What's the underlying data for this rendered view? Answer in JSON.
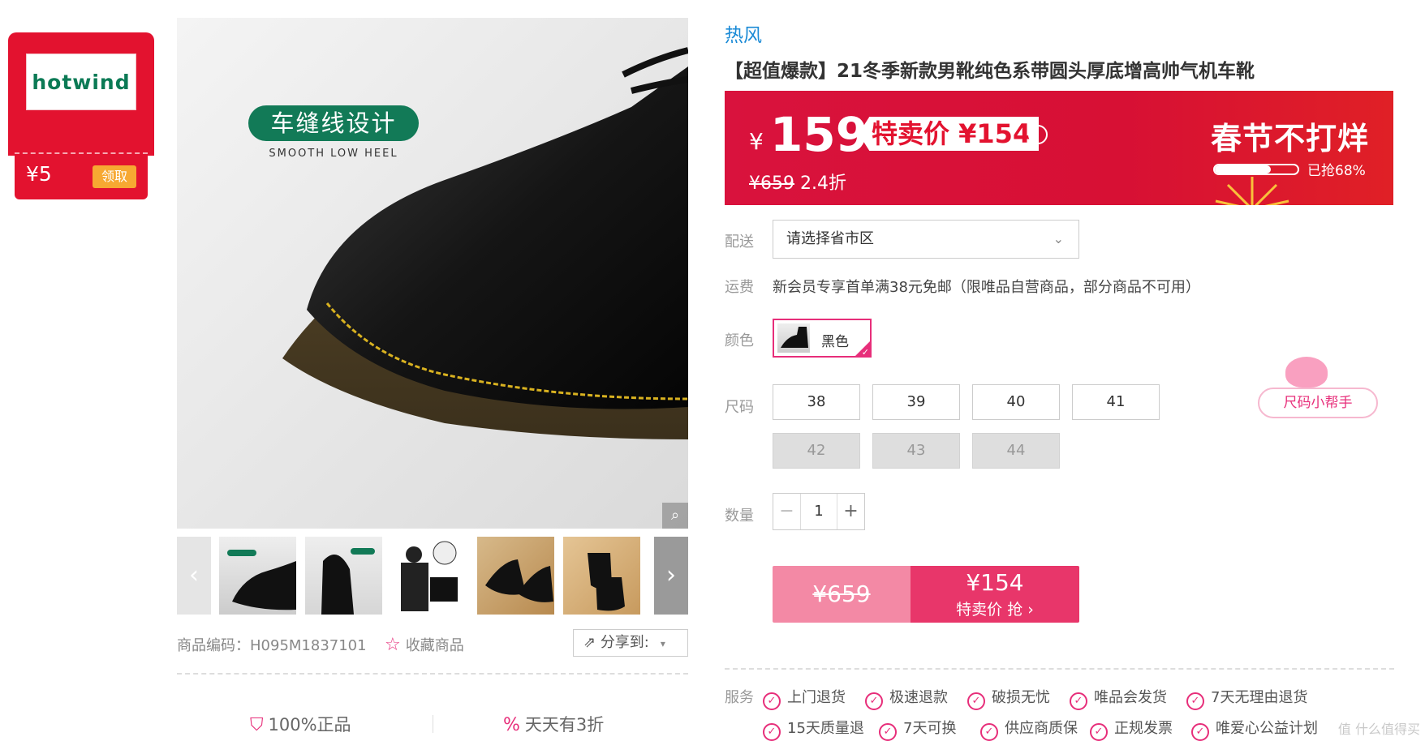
{
  "coupon": {
    "brand_logo": "hotwind",
    "amount": "¥5",
    "claim": "领取"
  },
  "gallery": {
    "badge_title": "车缝线设计",
    "badge_sub": "SMOOTH LOW HEEL",
    "prev_icon": "chevron-left-icon",
    "next_icon": "chevron-right-icon",
    "zoom_icon": "magnifier-icon",
    "thumbs": [
      "thumb-1",
      "thumb-2",
      "thumb-3",
      "thumb-4",
      "thumb-5"
    ]
  },
  "meta": {
    "product_code": "商品编码：H095M1837101",
    "favorite": "收藏商品",
    "share": "分享到:"
  },
  "guarantees": [
    "100%正品",
    "天天有3折"
  ],
  "product": {
    "brand": "热风",
    "title": "【超值爆款】21冬季新款男靴纯色系带圆头厚底增高帅气机车靴"
  },
  "price_banner": {
    "currency": "¥",
    "price": "159",
    "special_tag": "特卖价 ¥154",
    "info_icon": "info-icon",
    "original": "¥659",
    "discount": "2.4折",
    "promo_title": "春节不打烊",
    "grabbed_label": "已抢68%",
    "grabbed_fraction": 0.68
  },
  "delivery": {
    "label": "配送",
    "placeholder": "请选择省市区"
  },
  "shipping": {
    "label": "运费",
    "text": "新会员专享首单满38元免邮（限唯品自营商品，部分商品不可用）"
  },
  "color": {
    "label": "颜色",
    "selected": "黑色"
  },
  "sizes": {
    "label": "尺码",
    "available": [
      "38",
      "39",
      "40",
      "41"
    ],
    "unavailable": [
      "42",
      "43",
      "44"
    ],
    "helper": "尺码小帮手"
  },
  "quantity": {
    "label": "数量",
    "minus": "−",
    "value": "1",
    "plus": "+"
  },
  "buy": {
    "original": "¥659",
    "price": "¥154",
    "action": "特卖价 抢 ›"
  },
  "services": {
    "label": "服务",
    "row1": [
      "上门退货",
      "极速退款",
      "破损无忧",
      "唯品会发货",
      "7天无理由退货"
    ],
    "row2": [
      "15天质量退",
      "7天可换",
      "供应商质保",
      "正规发票",
      "唯爱心公益计划"
    ]
  },
  "watermark": "值 什么值得买",
  "colors": {
    "accent": "#e72e7a",
    "banner_red": "#d9123d",
    "brand_blue": "#1a8ad6"
  }
}
